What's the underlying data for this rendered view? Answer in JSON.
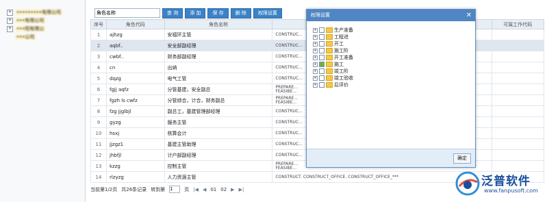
{
  "tree": [
    {
      "label": "•••••••••有限公司",
      "sign": "+"
    },
    {
      "label": "•••有限公司",
      "sign": "+"
    },
    {
      "label": "•••阳有限公",
      "sign": "+"
    },
    {
      "label": "•••公司",
      "sign": ""
    }
  ],
  "search": {
    "value": "角色名称"
  },
  "toolbar": {
    "query": "查 询",
    "add": "添 加",
    "save": "保 存",
    "delete": "删 除",
    "perm": "权限设置"
  },
  "columns": {
    "idx": "序号",
    "code": "角色代码",
    "name": "角色名称",
    "perm": "",
    "flow": "可属工作代码"
  },
  "rows": [
    {
      "n": "1",
      "code": "ajhzg",
      "name": "安福环主管",
      "perm": "CONSTRUC..."
    },
    {
      "n": "2",
      "code": "aqbf..",
      "name": "安全部副经理",
      "perm": "CONSTRUC..."
    },
    {
      "n": "3",
      "code": "cwbf..",
      "name": "财务部副经理",
      "perm": "CONSTRUC..."
    },
    {
      "n": "4",
      "code": "cn",
      "name": "出纳",
      "perm": "CONSTRUC..."
    },
    {
      "n": "5",
      "code": "dqzg",
      "name": "电气工管",
      "perm": "CONSTRUC..."
    },
    {
      "n": "6",
      "code": "fgjj aqfz",
      "name": "分管基建，安全副总",
      "perm": "PREPARE...\nFEASIBE..."
    },
    {
      "n": "7",
      "code": "fgzh ls cwfz",
      "name": "分管综合，计合，财务副总",
      "perm": "PREPARE...\nFEASIBE..."
    },
    {
      "n": "8",
      "code": "fzg jjglbjl",
      "name": "副总工，基建管理部经理",
      "perm": "CONSTRUC..."
    },
    {
      "n": "9",
      "code": "gyzg",
      "name": "服务主管",
      "perm": "CONSTRUC..."
    },
    {
      "n": "10",
      "code": "hsxj",
      "name": "核算会计",
      "perm": "CONSTRUC..."
    },
    {
      "n": "11",
      "code": "jjzgz1",
      "name": "基建主管助理",
      "perm": "CONSTRUC..."
    },
    {
      "n": "12",
      "code": "jhbfjl",
      "name": "计户部副经理",
      "perm": "CONSTRUC..."
    },
    {
      "n": "13",
      "code": "kzzg",
      "name": "控制主管",
      "perm": "PREPARE...\nFEASIBE..."
    },
    {
      "n": "14",
      "code": "rlzyzg",
      "name": "人力资源主管",
      "perm": "CONSTRUCT. CONSTRUCT_OFFICE. CONSTRUCT_OFFICE_***"
    }
  ],
  "footer": {
    "page_info": "当前第1/2页",
    "total": "共26条记录",
    "goto": "转到第",
    "page_val": "1",
    "page_unit": "页",
    "p1": "01",
    "p2": "02"
  },
  "dialog": {
    "title": "权限设置",
    "ok": "确定",
    "items": [
      {
        "label": "生产准备",
        "checked": false
      },
      {
        "label": "工程进",
        "checked": false
      },
      {
        "label": "开工",
        "checked": false
      },
      {
        "label": "施工阶",
        "checked": false
      },
      {
        "label": "开工准备",
        "checked": false
      },
      {
        "label": "施工",
        "checked": true
      },
      {
        "label": "竣工阶",
        "checked": false
      },
      {
        "label": "竣工验收",
        "checked": false
      },
      {
        "label": "后评价",
        "checked": false
      }
    ]
  },
  "logo": {
    "cn": "泛普软件",
    "url": "www.fanpusoft.com"
  },
  "colors": {
    "accent": "#3b82c6",
    "dialog_title": "#4f86c3",
    "logo": "#1a4f9c"
  }
}
